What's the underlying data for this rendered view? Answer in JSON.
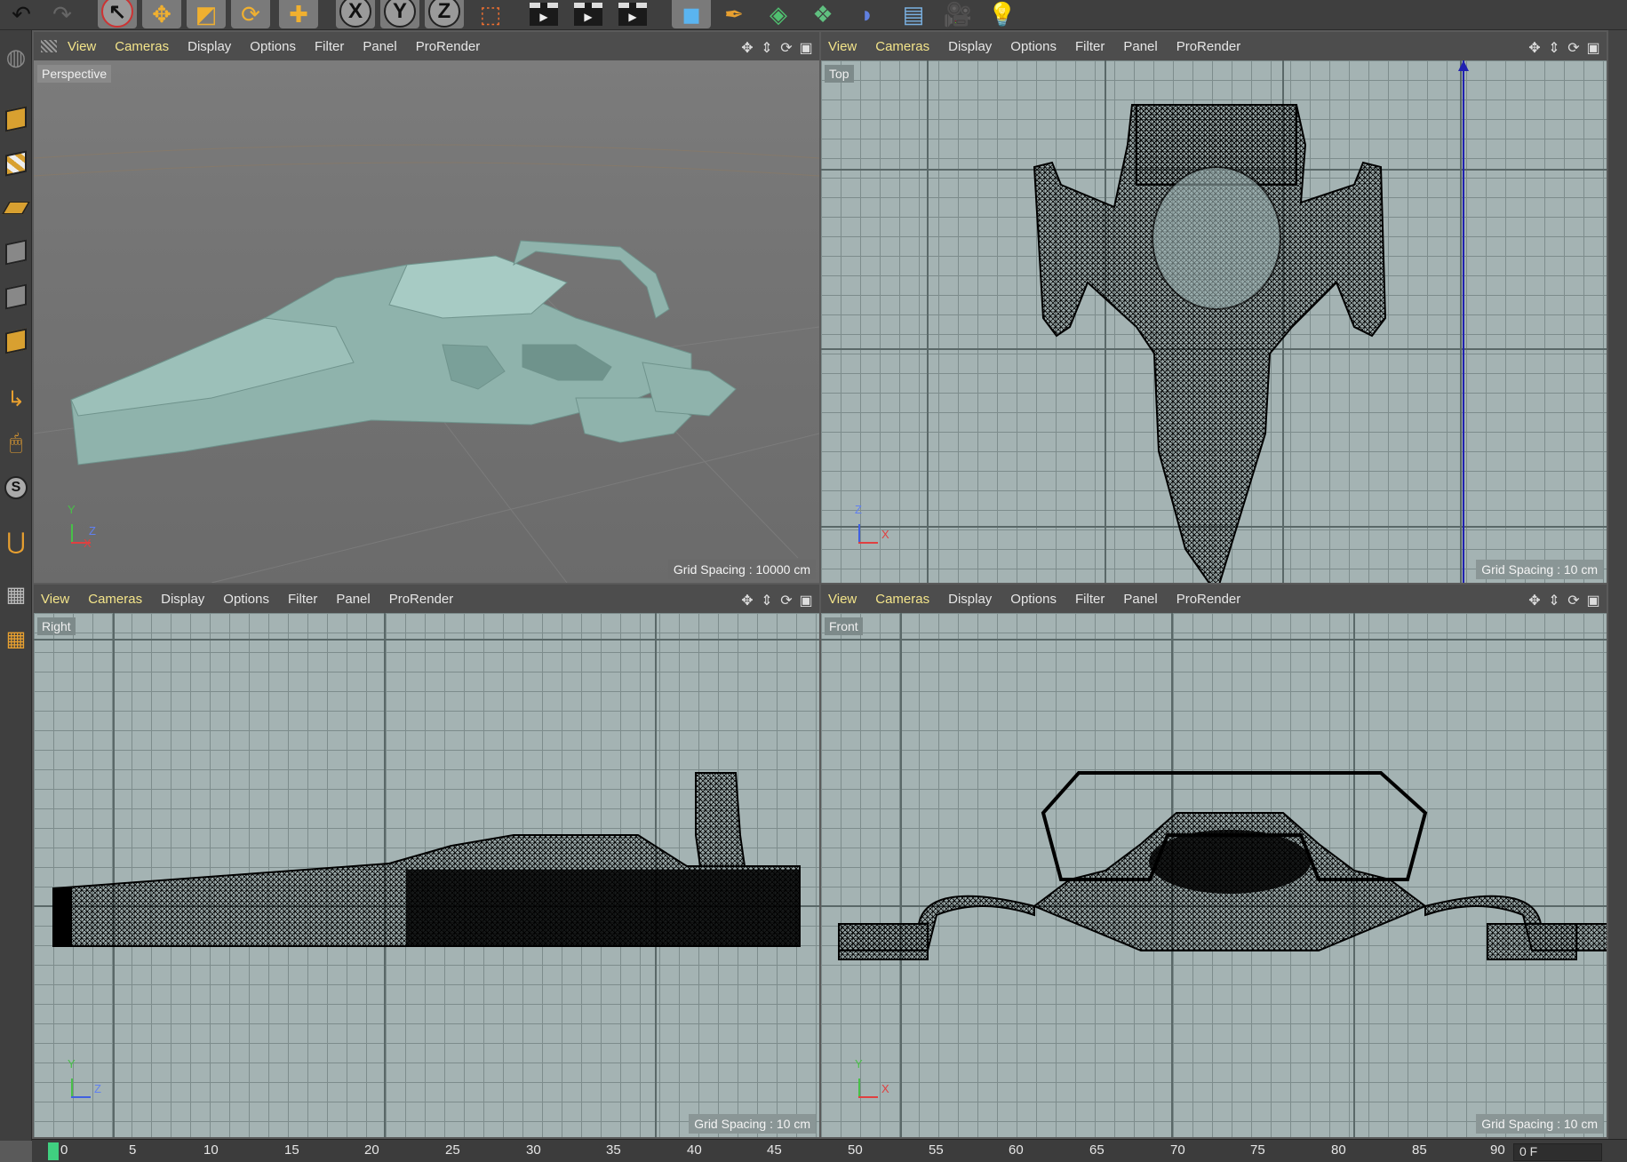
{
  "toolbar": {
    "axis_x": "X",
    "axis_y": "Y",
    "axis_z": "Z"
  },
  "viewports": [
    {
      "menu": [
        "View",
        "Cameras",
        "Display",
        "Options",
        "Filter",
        "Panel",
        "ProRender"
      ],
      "label": "Perspective",
      "grid_spacing": "Grid Spacing : 10000 cm",
      "axes": [
        "Y",
        "Z",
        "X"
      ]
    },
    {
      "menu": [
        "View",
        "Cameras",
        "Display",
        "Options",
        "Filter",
        "Panel",
        "ProRender"
      ],
      "label": "Top",
      "grid_spacing": "Grid Spacing : 10 cm",
      "axes": [
        "Z",
        "X"
      ]
    },
    {
      "menu": [
        "View",
        "Cameras",
        "Display",
        "Options",
        "Filter",
        "Panel",
        "ProRender"
      ],
      "label": "Right",
      "grid_spacing": "Grid Spacing : 10 cm",
      "axes": [
        "Y",
        "Z"
      ]
    },
    {
      "menu": [
        "View",
        "Cameras",
        "Display",
        "Options",
        "Filter",
        "Panel",
        "ProRender"
      ],
      "label": "Front",
      "grid_spacing": "Grid Spacing : 10 cm",
      "axes": [
        "Y",
        "X"
      ]
    }
  ],
  "timeline": {
    "ticks": [
      "0",
      "5",
      "10",
      "15",
      "20",
      "25",
      "30",
      "35",
      "40",
      "45",
      "50",
      "55",
      "60",
      "65",
      "70",
      "75",
      "80",
      "85",
      "90"
    ],
    "current_frame": "0 F"
  },
  "colors": {
    "active_menu": "#f3e48a",
    "viewport_bg": "#a4b3b3",
    "model_color": "#8fb3ac",
    "wire_color": "#000000"
  }
}
